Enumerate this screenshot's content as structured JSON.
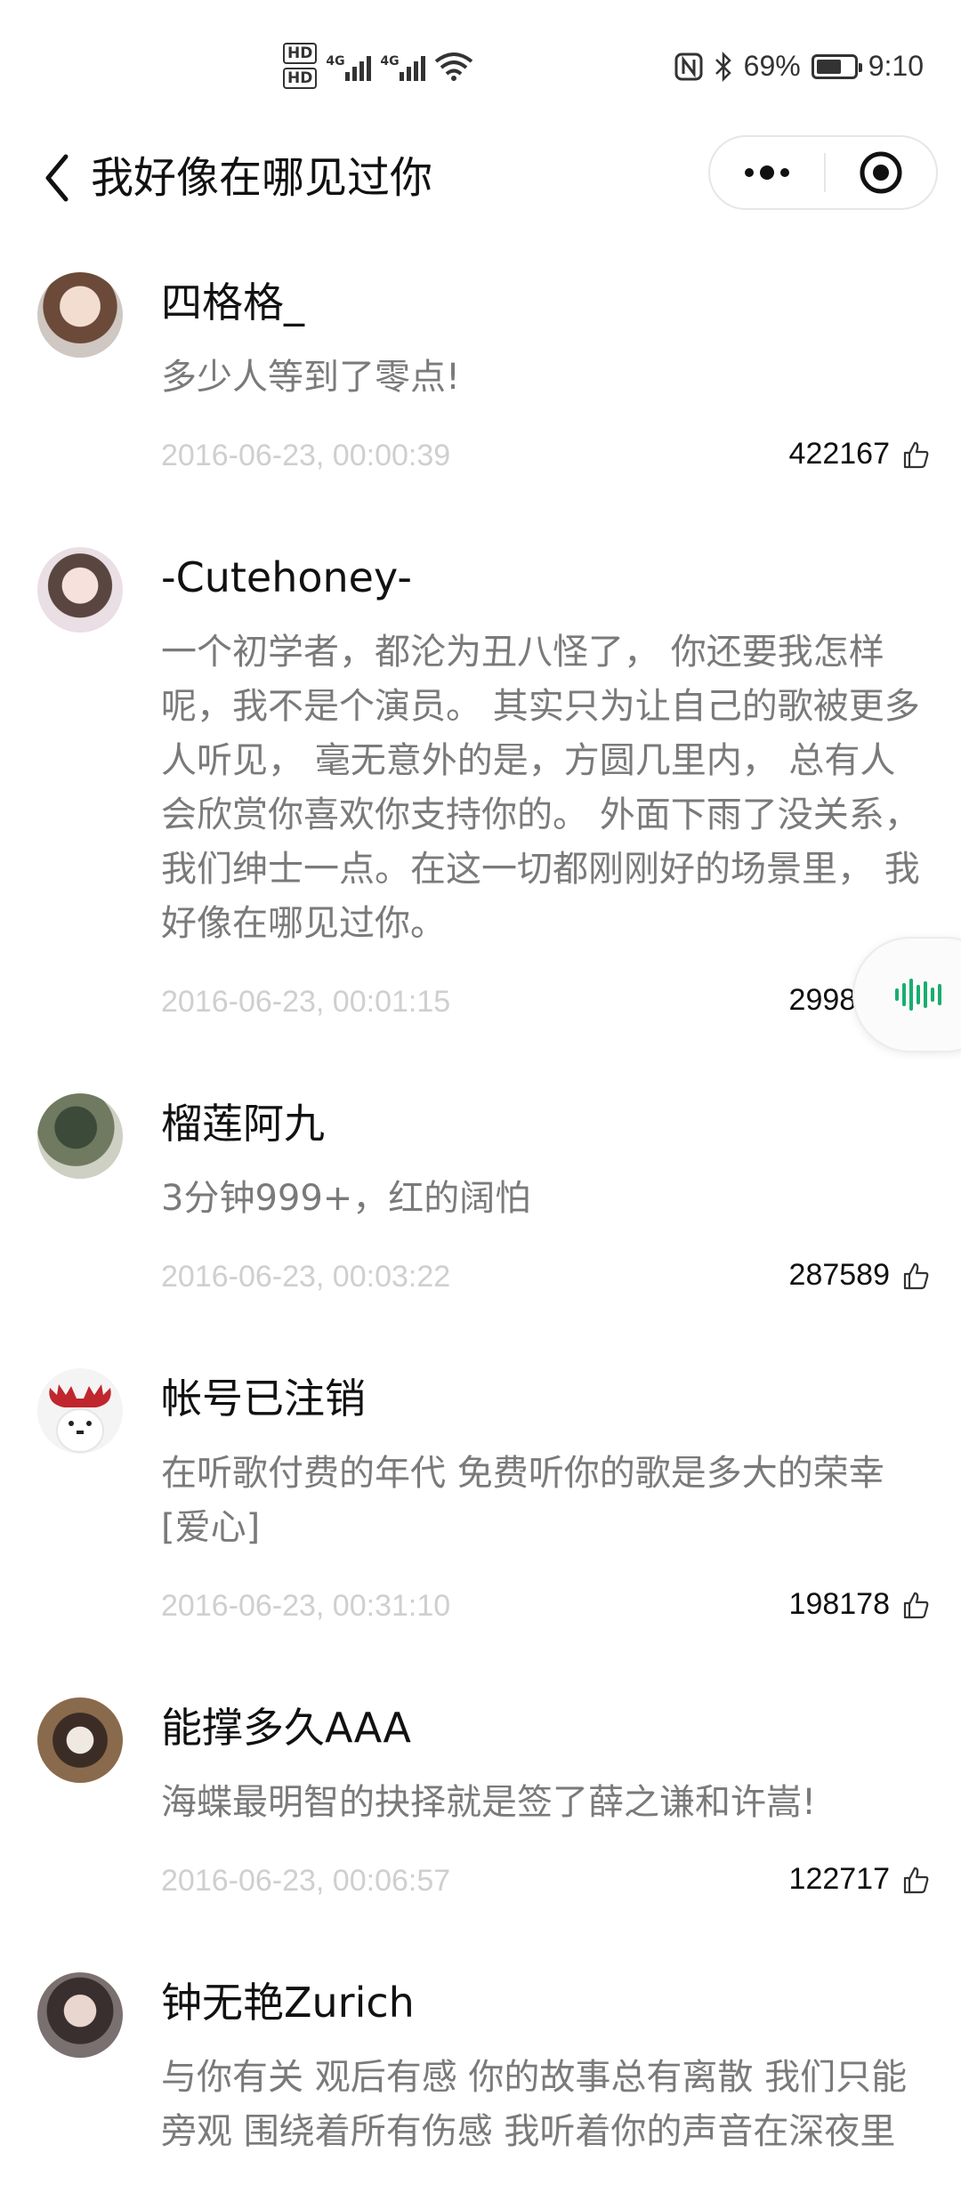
{
  "status_bar": {
    "hd1": "HD",
    "hd2": "HD",
    "sim1": "4G",
    "sim2": "4G",
    "battery_percent_text": "69%",
    "battery_level": 0.69,
    "time": "9:10"
  },
  "nav": {
    "title": "我好像在哪见过你"
  },
  "comments": [
    {
      "username": "四格格_",
      "content": "多少人等到了零点!",
      "timestamp": "2016-06-23, 00:00:39",
      "likes": "422167"
    },
    {
      "username": "-Cutehoney-",
      "content": "一个初学者，都沦为丑八怪了， 你还要我怎样呢，我不是个演员。 其实只为让自己的歌被更多人听见， 毫无意外的是，方圆几里内， 总有人会欣赏你喜欢你支持你的。 外面下雨了没关系，我们绅士一点。在这一切都刚刚好的场景里， 我好像在哪见过你。",
      "timestamp": "2016-06-23, 00:01:15",
      "likes": "299884"
    },
    {
      "username": "榴莲阿九",
      "content": "3分钟999+，红的阔怕",
      "timestamp": "2016-06-23, 00:03:22",
      "likes": "287589"
    },
    {
      "username": "帐号已注销",
      "content": "在听歌付费的年代 免费听你的歌是多大的荣幸[爱心]",
      "timestamp": "2016-06-23, 00:31:10",
      "likes": "198178"
    },
    {
      "username": "能撑多久AAA",
      "content": "海蝶最明智的抉择就是签了薛之谦和许嵩!",
      "timestamp": "2016-06-23, 00:06:57",
      "likes": "122717"
    },
    {
      "username": "钟无艳Zurich",
      "content": "与你有关 观后有感 你的故事总有离散 我们只能旁观 围绕着所有伤感 我听着你的声音在深夜里"
    }
  ],
  "colors": {
    "username": "#111111",
    "content": "#7a7a7a",
    "timestamp": "#cfcfcf",
    "voice_accent": "#1aad6e"
  },
  "icons": {
    "back": "chevron-left-icon",
    "more": "more-dots-icon",
    "close": "target-circle-icon",
    "like": "thumbs-up-icon",
    "voice": "voice-wave-icon"
  }
}
